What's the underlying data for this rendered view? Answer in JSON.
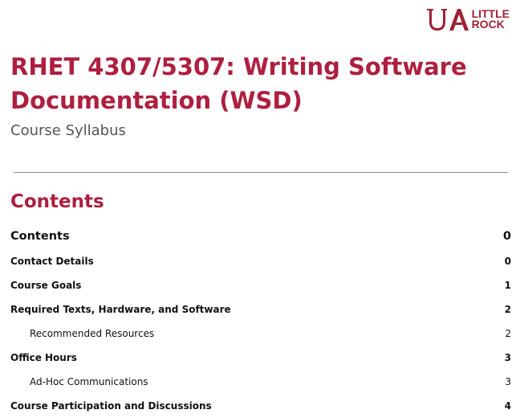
{
  "logo": {
    "mark": "UA",
    "line1": "LITTLE",
    "line2": "ROCK",
    "color": "#9d2235"
  },
  "document": {
    "title": "RHET 4307/5307: Writing Software Documentation (WSD)",
    "subtitle": "Course Syllabus",
    "contents_heading": "Contents",
    "accent_color": "#ae1f3f"
  },
  "toc": [
    {
      "label": "Contents",
      "page": "0",
      "level": "main"
    },
    {
      "label": "Contact Details",
      "page": "0",
      "level": "lvl1"
    },
    {
      "label": "Course Goals",
      "page": "1",
      "level": "lvl1"
    },
    {
      "label": "Required Texts, Hardware, and Software",
      "page": "2",
      "level": "lvl1"
    },
    {
      "label": "Recommended Resources",
      "page": "2",
      "level": "lvl2"
    },
    {
      "label": "Office Hours",
      "page": "3",
      "level": "lvl1"
    },
    {
      "label": "Ad-Hoc Communications",
      "page": "3",
      "level": "lvl2"
    },
    {
      "label": "Course Participation and Discussions",
      "page": "4",
      "level": "lvl1"
    }
  ]
}
